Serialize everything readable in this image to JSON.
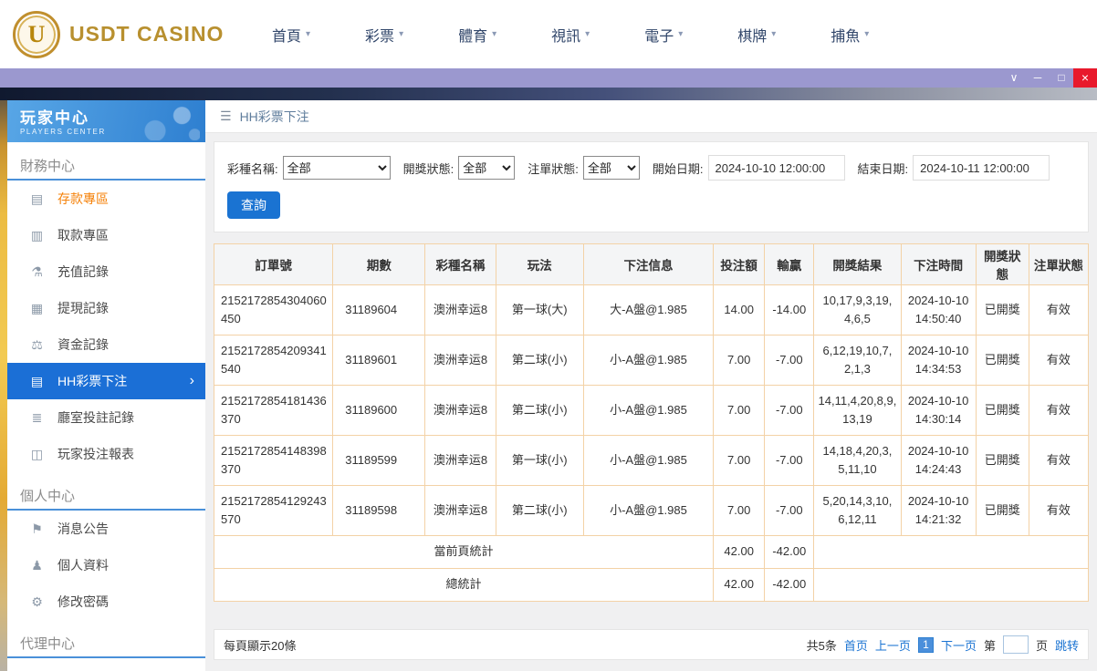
{
  "topnav": {
    "brand": "USDT CASINO",
    "logo_letter": "U",
    "items": [
      {
        "label": "首頁"
      },
      {
        "label": "彩票"
      },
      {
        "label": "體育"
      },
      {
        "label": "視訊"
      },
      {
        "label": "電子"
      },
      {
        "label": "棋牌"
      },
      {
        "label": "捕魚"
      }
    ]
  },
  "sidebar": {
    "title": "玩家中心",
    "subtitle": "PLAYERS CENTER",
    "active_color": "#1b6fd6",
    "sections": [
      {
        "header": "財務中心",
        "items": [
          {
            "label": "存款專區",
            "icon": "deposit-icon",
            "color": "#f5820a"
          },
          {
            "label": "取款專區",
            "icon": "withdraw-icon"
          },
          {
            "label": "充值記錄",
            "icon": "recharge-record-icon"
          },
          {
            "label": "提現記錄",
            "icon": "withdraw-record-icon"
          },
          {
            "label": "資金記錄",
            "icon": "funds-record-icon"
          },
          {
            "label": "HH彩票下注",
            "icon": "lottery-bet-icon",
            "active": true
          },
          {
            "label": "廳室投註記錄",
            "icon": "room-records-icon"
          },
          {
            "label": "玩家投注報表",
            "icon": "player-report-icon"
          }
        ]
      },
      {
        "header": "個人中心",
        "items": [
          {
            "label": "消息公告",
            "icon": "announcement-icon"
          },
          {
            "label": "個人資料",
            "icon": "profile-icon"
          },
          {
            "label": "修改密碼",
            "icon": "password-icon"
          }
        ]
      },
      {
        "header": "代理中心",
        "items": []
      }
    ]
  },
  "breadcrumb": {
    "title": "HH彩票下注"
  },
  "filters": {
    "lottery_label": "彩種名稱:",
    "lottery_value": "全部",
    "draw_status_label": "開獎狀態:",
    "draw_status_value": "全部",
    "order_status_label": "注單狀態:",
    "order_status_value": "全部",
    "start_label": "開始日期:",
    "start_value": "2024-10-10 12:00:00",
    "end_label": "結束日期:",
    "end_value": "2024-10-11 12:00:00",
    "query_button": "查詢"
  },
  "table": {
    "columns": [
      "訂單號",
      "期數",
      "彩種名稱",
      "玩法",
      "下注信息",
      "投注額",
      "輸贏",
      "開獎結果",
      "下注時間",
      "開獎狀態",
      "注單狀態"
    ],
    "rows": [
      [
        "2152172854304060450",
        "31189604",
        "澳洲幸运8",
        "第一球(大)",
        "大-A盤@1.985",
        "14.00",
        "-14.00",
        "10,17,9,3,19,4,6,5",
        "2024-10-10 14:50:40",
        "已開獎",
        "有效"
      ],
      [
        "2152172854209341540",
        "31189601",
        "澳洲幸运8",
        "第二球(小)",
        "小-A盤@1.985",
        "7.00",
        "-7.00",
        "6,12,19,10,7,2,1,3",
        "2024-10-10 14:34:53",
        "已開獎",
        "有效"
      ],
      [
        "2152172854181436370",
        "31189600",
        "澳洲幸运8",
        "第二球(小)",
        "小-A盤@1.985",
        "7.00",
        "-7.00",
        "14,11,4,20,8,9,13,19",
        "2024-10-10 14:30:14",
        "已開獎",
        "有效"
      ],
      [
        "2152172854148398370",
        "31189599",
        "澳洲幸运8",
        "第一球(小)",
        "小-A盤@1.985",
        "7.00",
        "-7.00",
        "14,18,4,20,3,5,11,10",
        "2024-10-10 14:24:43",
        "已開獎",
        "有效"
      ],
      [
        "2152172854129243570",
        "31189598",
        "澳洲幸运8",
        "第二球(小)",
        "小-A盤@1.985",
        "7.00",
        "-7.00",
        "5,20,14,3,10,6,12,11",
        "2024-10-10 14:21:32",
        "已開獎",
        "有效"
      ]
    ],
    "summary_rows": [
      {
        "label": "當前頁統計",
        "bet": "42.00",
        "winloss": "-42.00"
      },
      {
        "label": "總統計",
        "bet": "42.00",
        "winloss": "-42.00"
      }
    ]
  },
  "pagination": {
    "page_size_text": "每頁顯示20條",
    "total_text": "共5条",
    "first": "首页",
    "prev": "上一页",
    "current": "1",
    "next": "下一页",
    "jump_pre": "第",
    "jump_post": "页",
    "jump": "跳转"
  },
  "icons": {
    "chevron-down-icon": "∨",
    "minimize-icon": "─",
    "maximize-icon": "□",
    "close-icon": "×",
    "menu-icon": "☰",
    "nav-caret-icon": "▾",
    "chevron-right-icon": "›",
    "deposit-icon": "▤",
    "withdraw-icon": "▥",
    "recharge-record-icon": "⚗",
    "withdraw-record-icon": "▦",
    "funds-record-icon": "⚖",
    "lottery-bet-icon": "▤",
    "room-records-icon": "≣",
    "player-report-icon": "◫",
    "announcement-icon": "⚑",
    "profile-icon": "♟",
    "password-icon": "⚙"
  },
  "colors": {
    "accent_blue": "#1a73d2",
    "titlebar_purple": "#9b98cf",
    "close_red": "#e8192c",
    "table_border_orange": "#f3d2a6",
    "brand_gold": "#b8902f",
    "deposit_orange": "#f5820a"
  }
}
